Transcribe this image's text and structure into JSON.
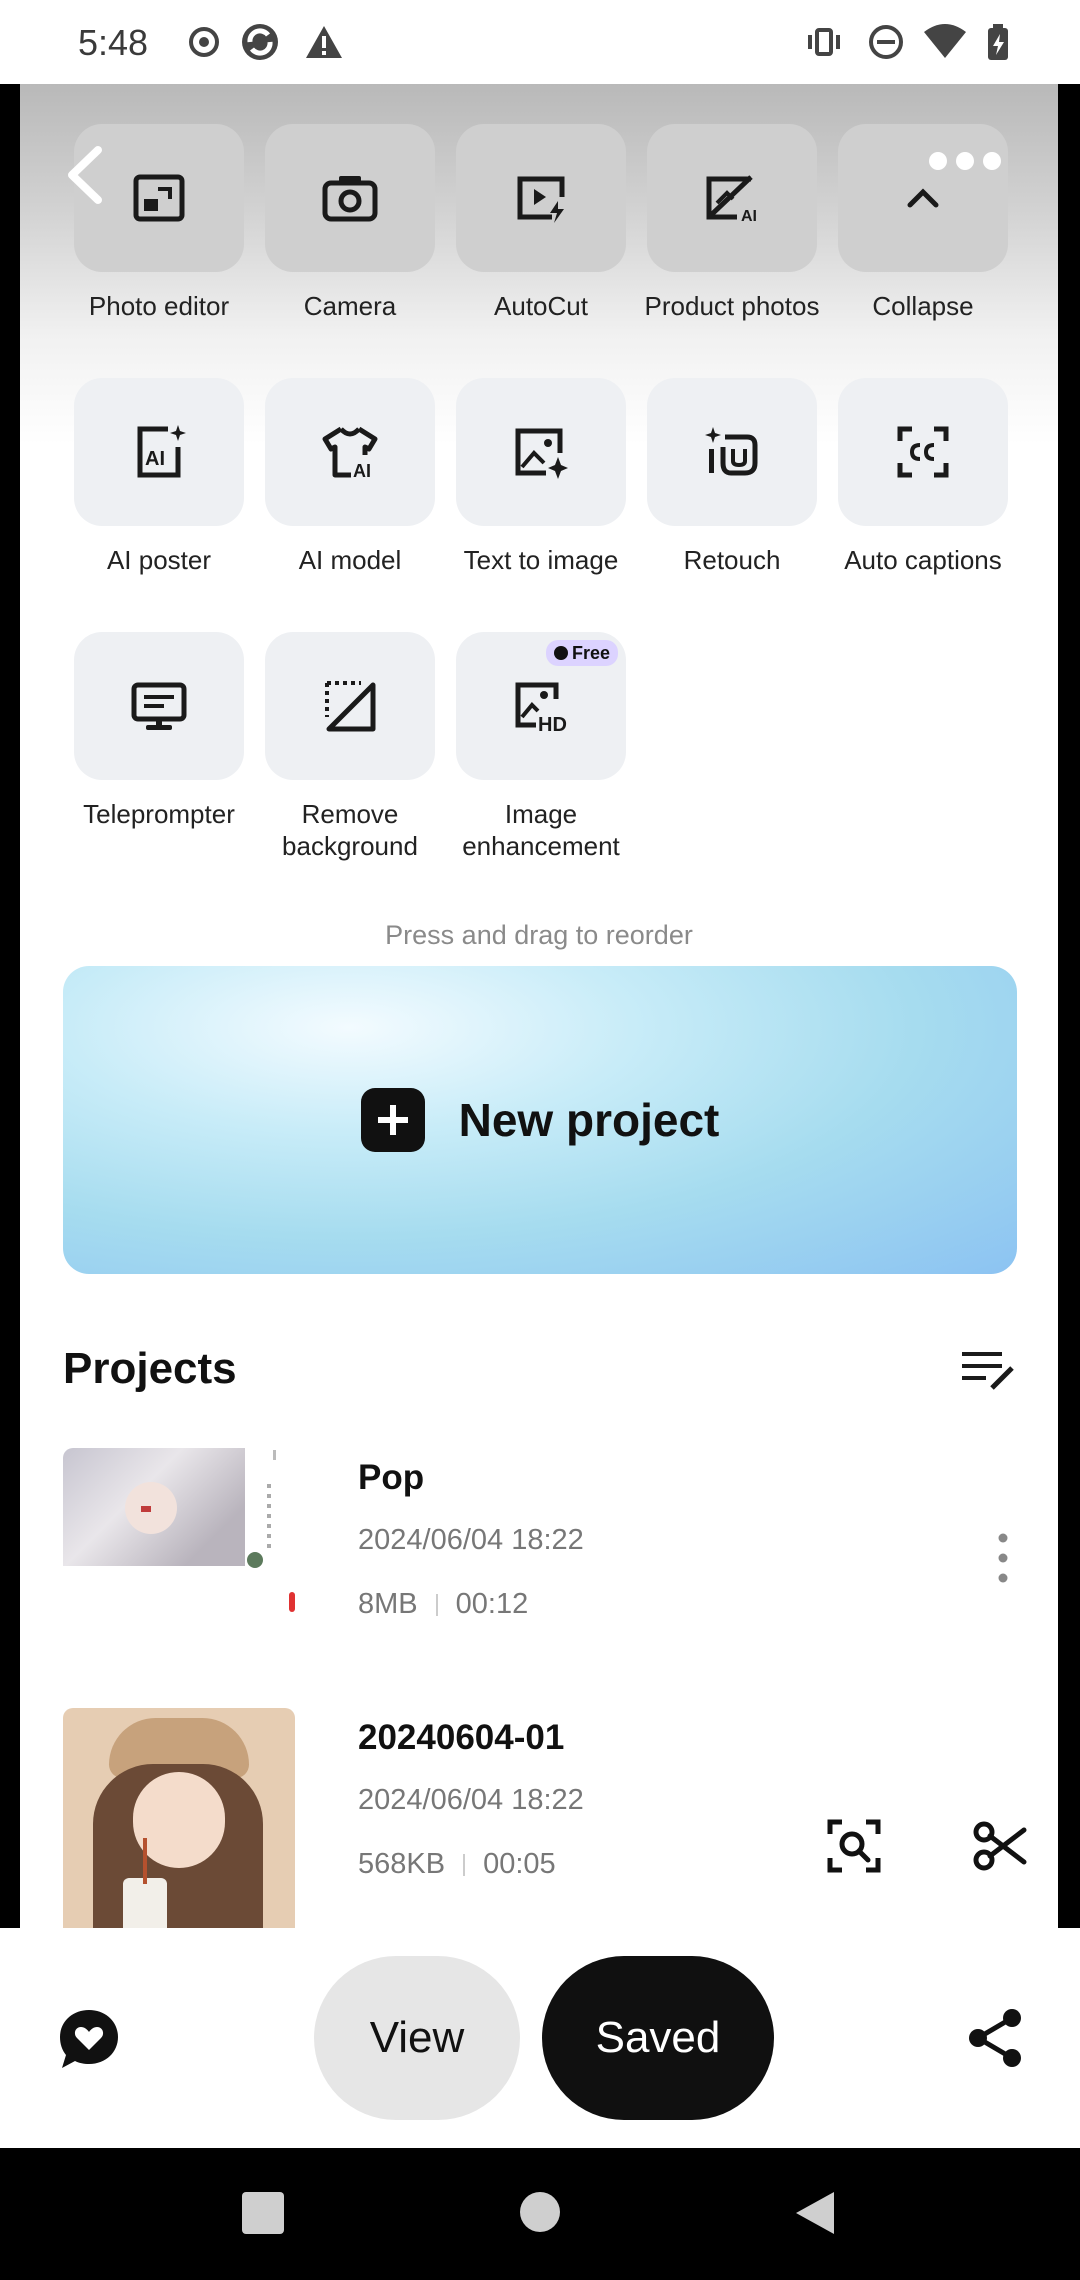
{
  "status_bar": {
    "time": "5:48"
  },
  "tools": [
    {
      "label": "Photo editor",
      "icon": "photo-editor-icon"
    },
    {
      "label": "Camera",
      "icon": "camera-icon"
    },
    {
      "label": "AutoCut",
      "icon": "autocut-icon"
    },
    {
      "label": "Product photos",
      "icon": "product-photos-icon"
    },
    {
      "label": "Collapse",
      "icon": "chevron-up-icon"
    },
    {
      "label": "AI poster",
      "icon": "ai-poster-icon"
    },
    {
      "label": "AI model",
      "icon": "ai-model-icon"
    },
    {
      "label": "Text to image",
      "icon": "text-to-image-icon"
    },
    {
      "label": "Retouch",
      "icon": "retouch-icon"
    },
    {
      "label": "Auto captions",
      "icon": "auto-captions-icon"
    },
    {
      "label": "Teleprompter",
      "icon": "teleprompter-icon"
    },
    {
      "label": "Remove background",
      "icon": "remove-background-icon"
    },
    {
      "label": "Image enhancement",
      "icon": "image-enhancement-icon",
      "badge": "Free"
    }
  ],
  "reorder_hint": "Press and drag to reorder",
  "new_project_label": "New project",
  "projects": {
    "title": "Projects",
    "items": [
      {
        "name": "Pop",
        "date": "2024/06/04 18:22",
        "size": "8MB",
        "duration": "00:12"
      },
      {
        "name": "20240604-01",
        "date": "2024/06/04 18:22",
        "size": "568KB",
        "duration": "00:05"
      }
    ]
  },
  "bottom_bar": {
    "view_label": "View",
    "saved_label": "Saved"
  }
}
